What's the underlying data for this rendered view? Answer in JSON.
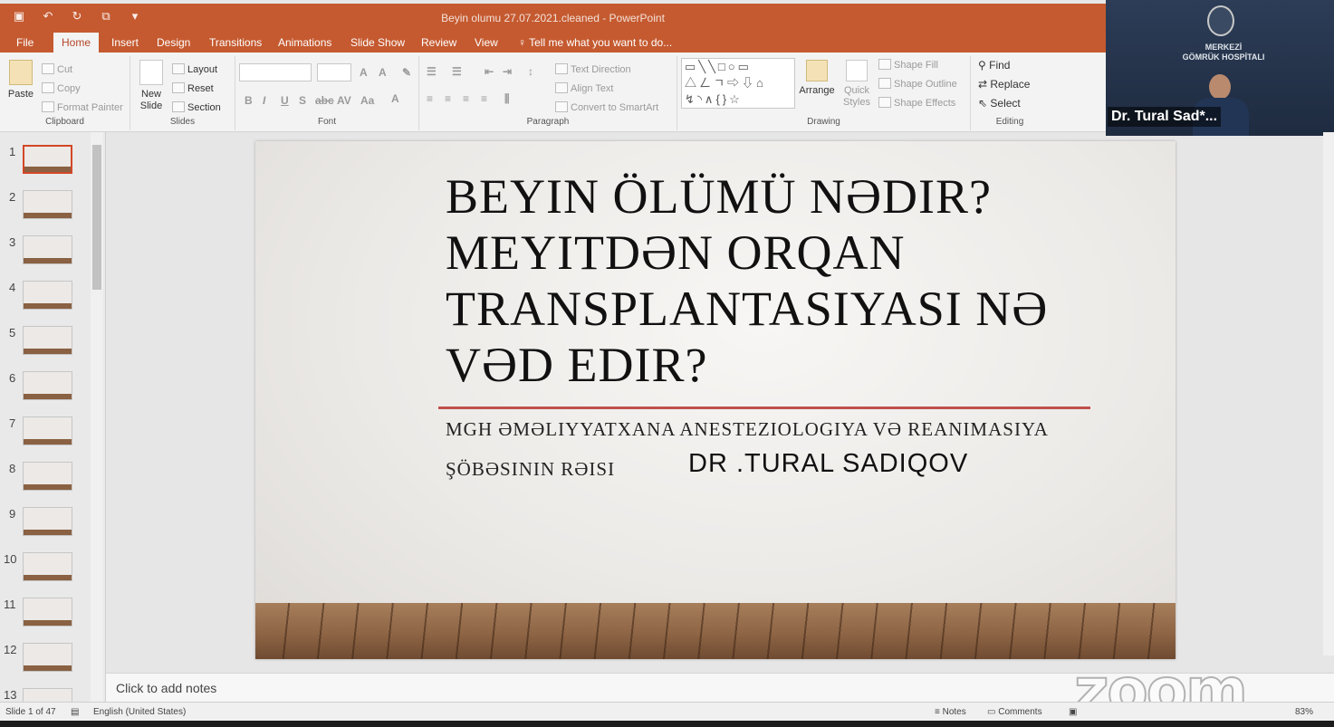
{
  "window": {
    "title": "Beyin olumu 27.07.2021.cleaned - PowerPoint"
  },
  "tabs": [
    {
      "label": "File"
    },
    {
      "label": "Home"
    },
    {
      "label": "Insert"
    },
    {
      "label": "Design"
    },
    {
      "label": "Transitions"
    },
    {
      "label": "Animations"
    },
    {
      "label": "Slide Show"
    },
    {
      "label": "Review"
    },
    {
      "label": "View"
    },
    {
      "label": "Tell me what you want to do..."
    }
  ],
  "ribbon": {
    "clipboard": {
      "paste": "Paste",
      "cut": "Cut",
      "copy": "Copy",
      "format_painter": "Format Painter",
      "label": "Clipboard"
    },
    "slides": {
      "new_slide": "New Slide",
      "layout": "Layout",
      "reset": "Reset",
      "section": "Section",
      "label": "Slides"
    },
    "font": {
      "label": "Font"
    },
    "paragraph": {
      "text_direction": "Text Direction",
      "align_text": "Align Text",
      "convert_smartart": "Convert to SmartArt",
      "label": "Paragraph"
    },
    "drawing": {
      "arrange": "Arrange",
      "quick_styles": "Quick Styles",
      "shape_fill": "Shape Fill",
      "shape_outline": "Shape Outline",
      "shape_effects": "Shape Effects",
      "label": "Drawing"
    },
    "editing": {
      "find": "Find",
      "replace": "Replace",
      "select": "Select",
      "label": "Editing"
    }
  },
  "video": {
    "participant": "Dr. Tural Sad*...",
    "hospital_line1": "MERKEZİ",
    "hospital_line2": "GÖMRÜK HOSPİTALI"
  },
  "thumbnails": [
    "1",
    "2",
    "3",
    "4",
    "5",
    "6",
    "7",
    "8",
    "9",
    "10",
    "11",
    "12",
    "13"
  ],
  "slide": {
    "title_lines": [
      "BEYIN ÖLÜMÜ NƏDIR?",
      "MEYITDƏN ORQAN",
      "TRANSPLANTASIYASI NƏ",
      "VƏD EDIR?"
    ],
    "subtitle_line1": "MGH   ƏMƏLIYYATXANA   ANESTEZIOLOGIYA  VƏ  REANIMASIYA",
    "subtitle_line2": "ŞÖBƏSININ RƏISI",
    "author": "DR .TURAL SADIQOV"
  },
  "notes": {
    "placeholder": "Click to add notes"
  },
  "status": {
    "slide_count": "Slide 1 of 47",
    "language": "English (United States)",
    "notes": "Notes",
    "comments": "Comments",
    "zoom": "83%"
  },
  "watermark": "zoom",
  "colors": {
    "accent": "#c55a30",
    "rule": "#c0504d",
    "selection": "#d24726"
  }
}
